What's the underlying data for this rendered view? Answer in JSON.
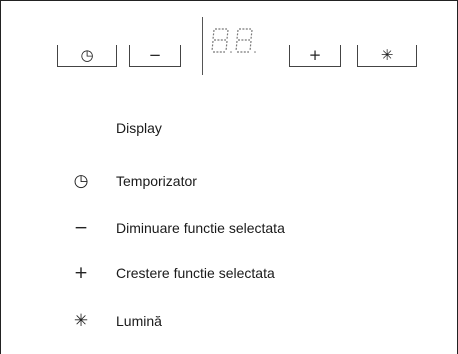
{
  "control_panel": {
    "buttons": [
      {
        "icon": "timer-icon",
        "glyph": "◷"
      },
      {
        "icon": "minus-icon",
        "glyph": "−"
      },
      {
        "icon": "plus-icon",
        "glyph": "+"
      },
      {
        "icon": "light-icon",
        "glyph": "✳"
      }
    ],
    "display_icon": "seven-segment-display-icon"
  },
  "legend": [
    {
      "icon": "",
      "glyph": "",
      "label": "Display"
    },
    {
      "icon": "timer-icon",
      "glyph": "◷",
      "label": "Temporizator"
    },
    {
      "icon": "minus-icon",
      "glyph": "−",
      "label": "Diminuare functie selectata"
    },
    {
      "icon": "plus-icon",
      "glyph": "+",
      "label": "Crestere functie selectata"
    },
    {
      "icon": "light-icon",
      "glyph": "✳",
      "label": "Lumină"
    }
  ]
}
